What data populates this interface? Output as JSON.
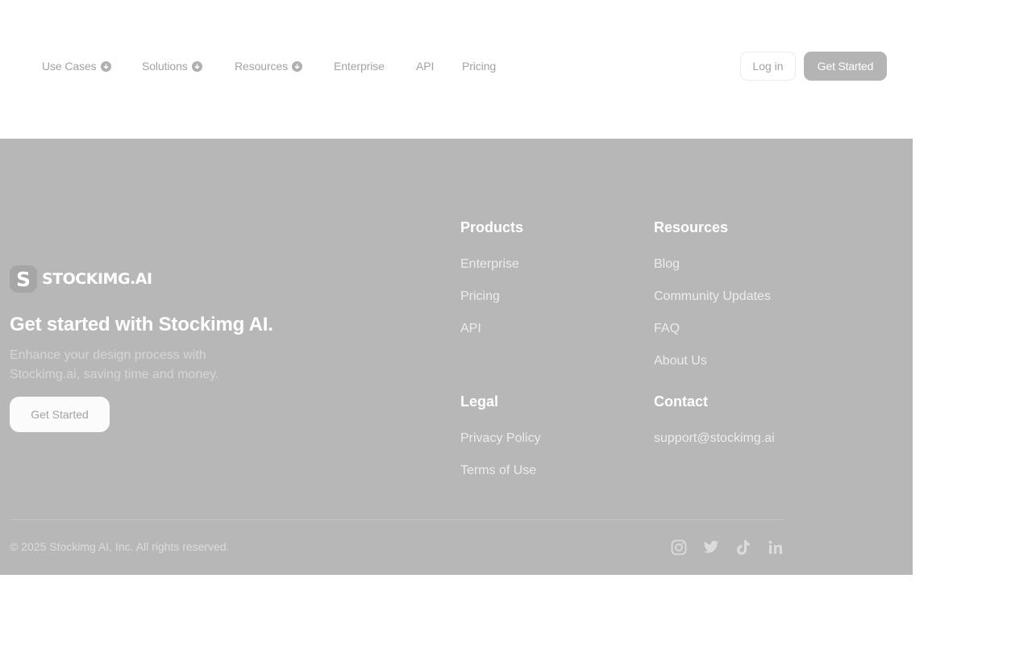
{
  "nav": {
    "items": [
      {
        "label": "Use Cases",
        "icon": "chevron-down-icon"
      },
      {
        "label": "Solutions",
        "icon": "chevron-down-icon"
      },
      {
        "label": "Resources",
        "icon": "chevron-down-icon"
      },
      {
        "label": "Enterprise"
      },
      {
        "label": "API"
      },
      {
        "label": "Pricing"
      }
    ],
    "login_label": "Log in",
    "get_started_label": "Get Started"
  },
  "footer": {
    "brand": {
      "mark": "S",
      "name": "STOCKIMG.AI"
    },
    "title": "Get started with Stockimg AI.",
    "description": "Enhance your design process with Stockimg.ai, saving time and money.",
    "cta_label": "Get Started",
    "columns": {
      "products": {
        "heading": "Products",
        "links": [
          "Enterprise",
          "Pricing",
          "API"
        ]
      },
      "resources": {
        "heading": "Resources",
        "links": [
          "Blog",
          "Community Updates",
          "FAQ",
          "About Us"
        ]
      },
      "legal": {
        "heading": "Legal",
        "links": [
          "Privacy Policy",
          "Terms of Use"
        ]
      },
      "contact": {
        "heading": "Contact",
        "links": [
          "support@stockimg.ai"
        ]
      }
    },
    "copyright": "© 2025 Stockimg AI, Inc. All rights reserved.",
    "social_icons": [
      "instagram-icon",
      "twitter-icon",
      "tiktok-icon",
      "linkedin-icon"
    ]
  },
  "colors": {
    "footer_bg": "#b7b7b7",
    "nav_text": "#a3a3a3",
    "primary_button": "#b4b4b4"
  }
}
